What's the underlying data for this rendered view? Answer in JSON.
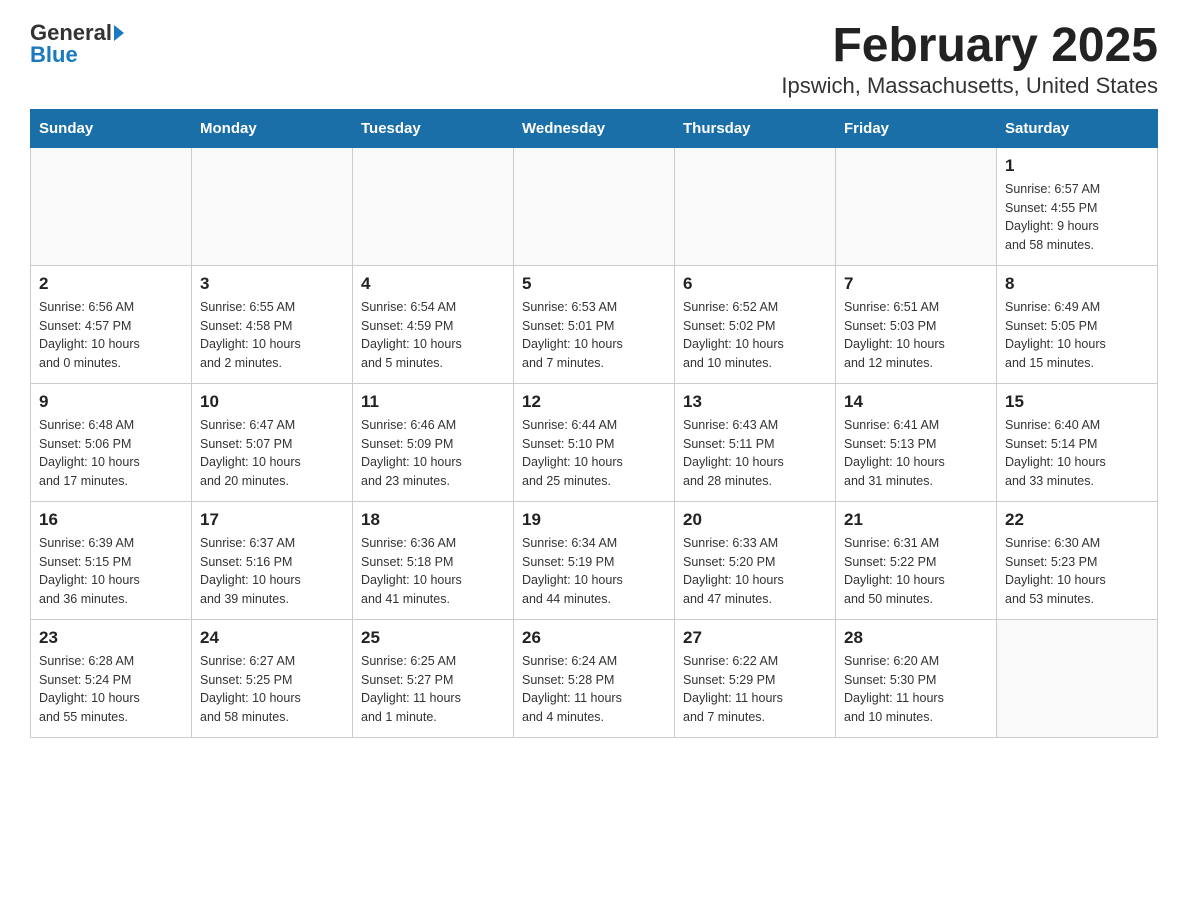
{
  "header": {
    "logo_general": "General",
    "logo_blue": "Blue",
    "title": "February 2025",
    "subtitle": "Ipswich, Massachusetts, United States"
  },
  "weekdays": [
    "Sunday",
    "Monday",
    "Tuesday",
    "Wednesday",
    "Thursday",
    "Friday",
    "Saturday"
  ],
  "weeks": [
    [
      {
        "day": "",
        "info": ""
      },
      {
        "day": "",
        "info": ""
      },
      {
        "day": "",
        "info": ""
      },
      {
        "day": "",
        "info": ""
      },
      {
        "day": "",
        "info": ""
      },
      {
        "day": "",
        "info": ""
      },
      {
        "day": "1",
        "info": "Sunrise: 6:57 AM\nSunset: 4:55 PM\nDaylight: 9 hours\nand 58 minutes."
      }
    ],
    [
      {
        "day": "2",
        "info": "Sunrise: 6:56 AM\nSunset: 4:57 PM\nDaylight: 10 hours\nand 0 minutes."
      },
      {
        "day": "3",
        "info": "Sunrise: 6:55 AM\nSunset: 4:58 PM\nDaylight: 10 hours\nand 2 minutes."
      },
      {
        "day": "4",
        "info": "Sunrise: 6:54 AM\nSunset: 4:59 PM\nDaylight: 10 hours\nand 5 minutes."
      },
      {
        "day": "5",
        "info": "Sunrise: 6:53 AM\nSunset: 5:01 PM\nDaylight: 10 hours\nand 7 minutes."
      },
      {
        "day": "6",
        "info": "Sunrise: 6:52 AM\nSunset: 5:02 PM\nDaylight: 10 hours\nand 10 minutes."
      },
      {
        "day": "7",
        "info": "Sunrise: 6:51 AM\nSunset: 5:03 PM\nDaylight: 10 hours\nand 12 minutes."
      },
      {
        "day": "8",
        "info": "Sunrise: 6:49 AM\nSunset: 5:05 PM\nDaylight: 10 hours\nand 15 minutes."
      }
    ],
    [
      {
        "day": "9",
        "info": "Sunrise: 6:48 AM\nSunset: 5:06 PM\nDaylight: 10 hours\nand 17 minutes."
      },
      {
        "day": "10",
        "info": "Sunrise: 6:47 AM\nSunset: 5:07 PM\nDaylight: 10 hours\nand 20 minutes."
      },
      {
        "day": "11",
        "info": "Sunrise: 6:46 AM\nSunset: 5:09 PM\nDaylight: 10 hours\nand 23 minutes."
      },
      {
        "day": "12",
        "info": "Sunrise: 6:44 AM\nSunset: 5:10 PM\nDaylight: 10 hours\nand 25 minutes."
      },
      {
        "day": "13",
        "info": "Sunrise: 6:43 AM\nSunset: 5:11 PM\nDaylight: 10 hours\nand 28 minutes."
      },
      {
        "day": "14",
        "info": "Sunrise: 6:41 AM\nSunset: 5:13 PM\nDaylight: 10 hours\nand 31 minutes."
      },
      {
        "day": "15",
        "info": "Sunrise: 6:40 AM\nSunset: 5:14 PM\nDaylight: 10 hours\nand 33 minutes."
      }
    ],
    [
      {
        "day": "16",
        "info": "Sunrise: 6:39 AM\nSunset: 5:15 PM\nDaylight: 10 hours\nand 36 minutes."
      },
      {
        "day": "17",
        "info": "Sunrise: 6:37 AM\nSunset: 5:16 PM\nDaylight: 10 hours\nand 39 minutes."
      },
      {
        "day": "18",
        "info": "Sunrise: 6:36 AM\nSunset: 5:18 PM\nDaylight: 10 hours\nand 41 minutes."
      },
      {
        "day": "19",
        "info": "Sunrise: 6:34 AM\nSunset: 5:19 PM\nDaylight: 10 hours\nand 44 minutes."
      },
      {
        "day": "20",
        "info": "Sunrise: 6:33 AM\nSunset: 5:20 PM\nDaylight: 10 hours\nand 47 minutes."
      },
      {
        "day": "21",
        "info": "Sunrise: 6:31 AM\nSunset: 5:22 PM\nDaylight: 10 hours\nand 50 minutes."
      },
      {
        "day": "22",
        "info": "Sunrise: 6:30 AM\nSunset: 5:23 PM\nDaylight: 10 hours\nand 53 minutes."
      }
    ],
    [
      {
        "day": "23",
        "info": "Sunrise: 6:28 AM\nSunset: 5:24 PM\nDaylight: 10 hours\nand 55 minutes."
      },
      {
        "day": "24",
        "info": "Sunrise: 6:27 AM\nSunset: 5:25 PM\nDaylight: 10 hours\nand 58 minutes."
      },
      {
        "day": "25",
        "info": "Sunrise: 6:25 AM\nSunset: 5:27 PM\nDaylight: 11 hours\nand 1 minute."
      },
      {
        "day": "26",
        "info": "Sunrise: 6:24 AM\nSunset: 5:28 PM\nDaylight: 11 hours\nand 4 minutes."
      },
      {
        "day": "27",
        "info": "Sunrise: 6:22 AM\nSunset: 5:29 PM\nDaylight: 11 hours\nand 7 minutes."
      },
      {
        "day": "28",
        "info": "Sunrise: 6:20 AM\nSunset: 5:30 PM\nDaylight: 11 hours\nand 10 minutes."
      },
      {
        "day": "",
        "info": ""
      }
    ]
  ]
}
